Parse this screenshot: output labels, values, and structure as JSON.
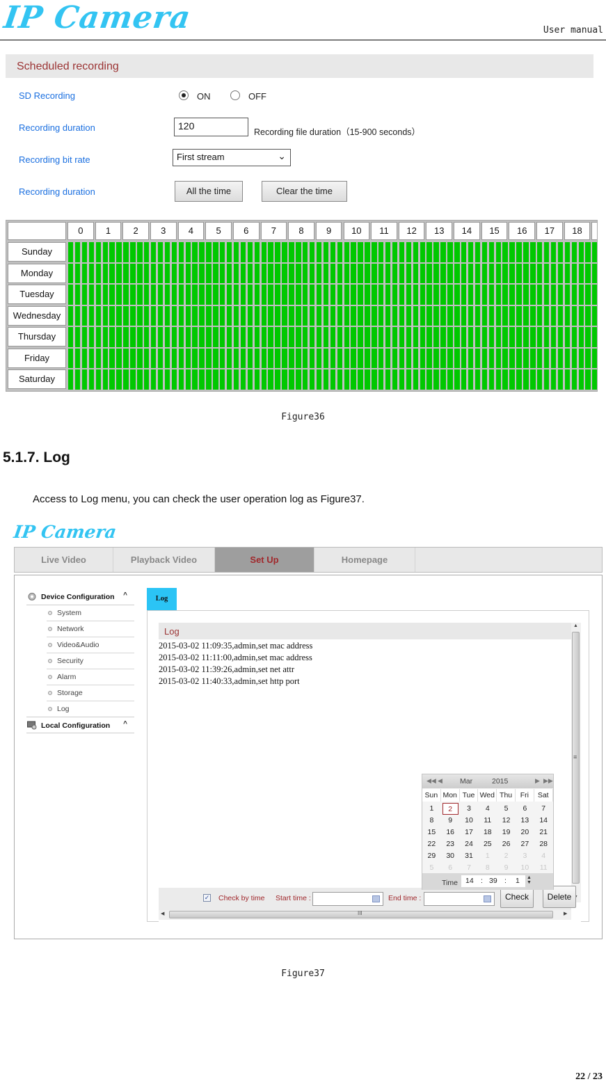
{
  "page": {
    "logo_text": "IP Camera",
    "doc_type": "User manual",
    "page_number": "22 / 23"
  },
  "figure36": {
    "panel_title": "Scheduled recording",
    "sd_recording": {
      "label": "SD Recording",
      "options": [
        {
          "label": "ON",
          "selected": true
        },
        {
          "label": "OFF",
          "selected": false
        }
      ]
    },
    "recording_duration": {
      "label": "Recording duration",
      "value": "120",
      "note": "Recording file duration（15-900 seconds）"
    },
    "recording_bit_rate": {
      "label": "Recording bit rate",
      "selected": "First stream"
    },
    "recording_schedule": {
      "label": "Recording duration",
      "all_time_button": "All the time",
      "clear_time_button": "Clear the time"
    },
    "schedule_grid": {
      "hours_visible": [
        "0",
        "1",
        "2",
        "3",
        "4",
        "5",
        "6",
        "7",
        "8",
        "9",
        "10",
        "11",
        "12",
        "13",
        "14",
        "15",
        "16",
        "17",
        "18"
      ],
      "slots_per_hour": 4,
      "days": [
        "Sunday",
        "Monday",
        "Tuesday",
        "Wednesday",
        "Thursday",
        "Friday",
        "Saturday"
      ],
      "all_slots_enabled": true,
      "enabled_color": "#00c800"
    },
    "caption": "Figure36"
  },
  "section": {
    "heading": "5.1.7.  Log",
    "body": "Access to Log menu, you can check the user operation log as Figure37."
  },
  "figure37": {
    "logo_text": "IP Camera",
    "nav_tabs": [
      {
        "label": "Live Video",
        "active": false
      },
      {
        "label": "Playback Video",
        "active": false
      },
      {
        "label": "Set Up",
        "active": true
      },
      {
        "label": "Homepage",
        "active": false
      }
    ],
    "sidebar": {
      "device_configuration": "Device Configuration",
      "items": [
        "System",
        "Network",
        "Video&Audio",
        "Security",
        "Alarm",
        "Storage",
        "Log"
      ],
      "local_configuration": "Local Configuration",
      "caret": "^"
    },
    "content_tab": "Log",
    "log_header": "Log",
    "log_entries": [
      "2015-03-02 11:09:35,admin,set mac address",
      "2015-03-02 11:11:00,admin,set mac address",
      "2015-03-02 11:39:26,admin,set net attr",
      "2015-03-02 11:40:33,admin,set http port"
    ],
    "filter": {
      "check_by_time_checked": true,
      "check_by_time_label": "Check by time",
      "start_time_label": "Start time :",
      "start_time_value": "",
      "end_time_label": "End time :",
      "end_time_value": "",
      "check_button": "Check",
      "delete_button": "Delete"
    },
    "calendar": {
      "month": "Mar",
      "year": "2015",
      "weekdays": [
        "Sun",
        "Mon",
        "Tue",
        "Wed",
        "Thu",
        "Fri",
        "Sat"
      ],
      "weeks": [
        [
          "1",
          "2",
          "3",
          "4",
          "5",
          "6",
          "7"
        ],
        [
          "8",
          "9",
          "10",
          "11",
          "12",
          "13",
          "14"
        ],
        [
          "15",
          "16",
          "17",
          "18",
          "19",
          "20",
          "21"
        ],
        [
          "22",
          "23",
          "24",
          "25",
          "26",
          "27",
          "28"
        ],
        [
          "29",
          "30",
          "31",
          "1",
          "2",
          "3",
          "4"
        ],
        [
          "5",
          "6",
          "7",
          "8",
          "9",
          "10",
          "11"
        ]
      ],
      "selected_day": "2",
      "time_label": "Time",
      "hour": "14",
      "minute": "39",
      "second": "1"
    },
    "caption": "Figure37"
  }
}
